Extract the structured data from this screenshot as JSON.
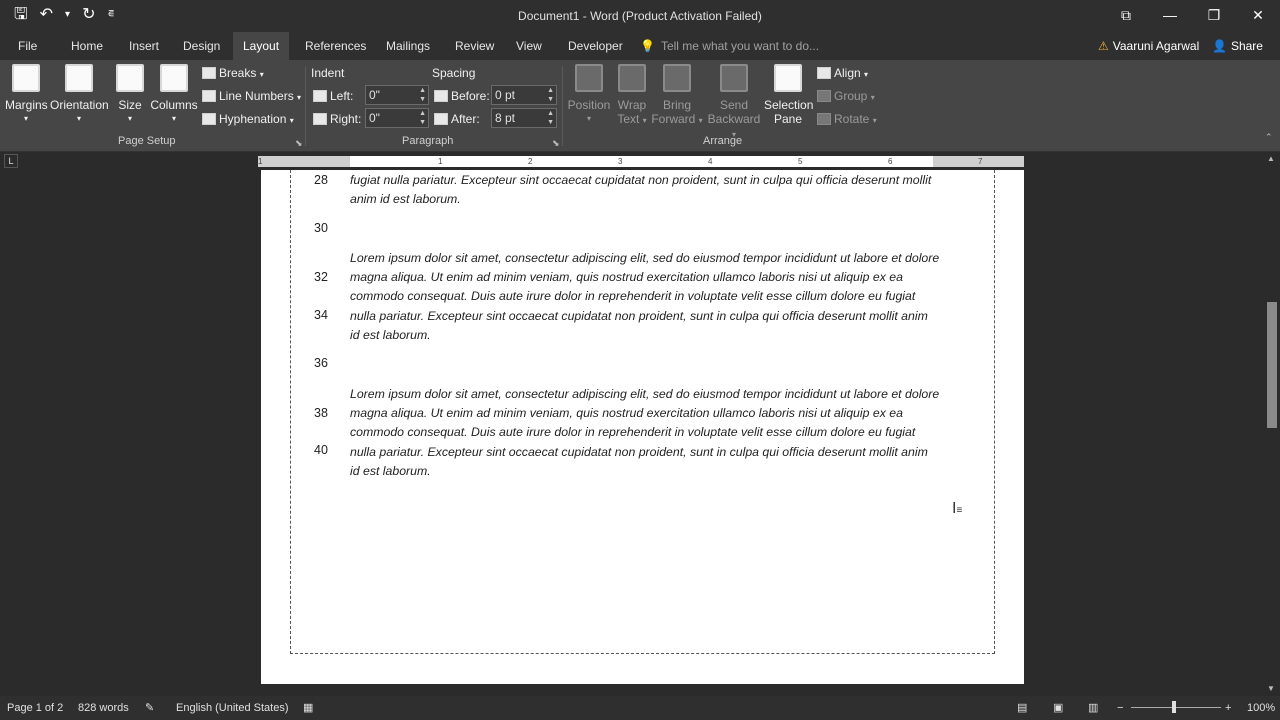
{
  "window": {
    "title": "Document1 - Word (Product Activation Failed)",
    "qat": {
      "save": "🖫",
      "undo": "↶",
      "undo_more": "▾",
      "redo": "↻",
      "customize": "⋷"
    },
    "controls": {
      "ribbon_display": "⧉",
      "minimize": "—",
      "restore": "❐",
      "close": "✕"
    }
  },
  "tabs": [
    "File",
    "Home",
    "Insert",
    "Design",
    "Layout",
    "References",
    "Mailings",
    "Review",
    "View",
    "Developer"
  ],
  "active_tab": "Layout",
  "tell_me": "Tell me what you want to do...",
  "user": {
    "name": "Vaaruni Agarwal",
    "warning_icon": "⚠"
  },
  "share_label": "Share",
  "ribbon": {
    "page_setup": {
      "label": "Page Setup",
      "margins": "Margins",
      "orientation": "Orientation",
      "size": "Size",
      "columns": "Columns",
      "breaks": "Breaks",
      "line_numbers": "Line Numbers",
      "hyphenation": "Hyphenation"
    },
    "paragraph": {
      "label": "Paragraph",
      "indent": "Indent",
      "spacing": "Spacing",
      "left_label": "Left:",
      "left_value": "0\"",
      "right_label": "Right:",
      "right_value": "0\"",
      "before_label": "Before:",
      "before_value": "0 pt",
      "after_label": "After:",
      "after_value": "8 pt"
    },
    "arrange": {
      "label": "Arrange",
      "position": "Position",
      "wrap_text_1": "Wrap",
      "wrap_text_2": "Text",
      "bring_forward_1": "Bring",
      "bring_forward_2": "Forward",
      "send_backward_1": "Send",
      "send_backward_2": "Backward",
      "selection_pane_1": "Selection",
      "selection_pane_2": "Pane",
      "align": "Align",
      "group": "Group",
      "rotate": "Rotate"
    }
  },
  "ruler": {
    "numbers": [
      "1",
      "1",
      "2",
      "3",
      "4",
      "5",
      "6",
      "7"
    ]
  },
  "document": {
    "line_numbers": [
      "28",
      "30",
      "32",
      "34",
      "36",
      "38",
      "40"
    ],
    "para_tail": "fugiat nulla pariatur. Excepteur sint occaecat cupidatat non proident, sunt in culpa qui officia deserunt mollit anim id est laborum.",
    "para_full": "Lorem ipsum dolor sit amet, consectetur adipiscing elit, sed do eiusmod tempor incididunt ut labore et dolore magna aliqua. Ut enim ad minim veniam, quis nostrud exercitation ullamco laboris nisi ut aliquip ex ea commodo consequat. Duis aute irure dolor in reprehenderit in voluptate velit esse cillum dolore eu fugiat nulla pariatur. Excepteur sint occaecat cupidatat non proident, sunt in culpa qui officia deserunt mollit anim id est laborum."
  },
  "status": {
    "page": "Page 1 of 2",
    "words": "828 words",
    "language": "English (United States)",
    "zoom": "100%",
    "zoom_out": "−",
    "zoom_in": "+"
  },
  "colors": {
    "ribbon_bg": "#464646",
    "titlebar_bg": "#2f2f2f",
    "warning": "#f2b233"
  }
}
